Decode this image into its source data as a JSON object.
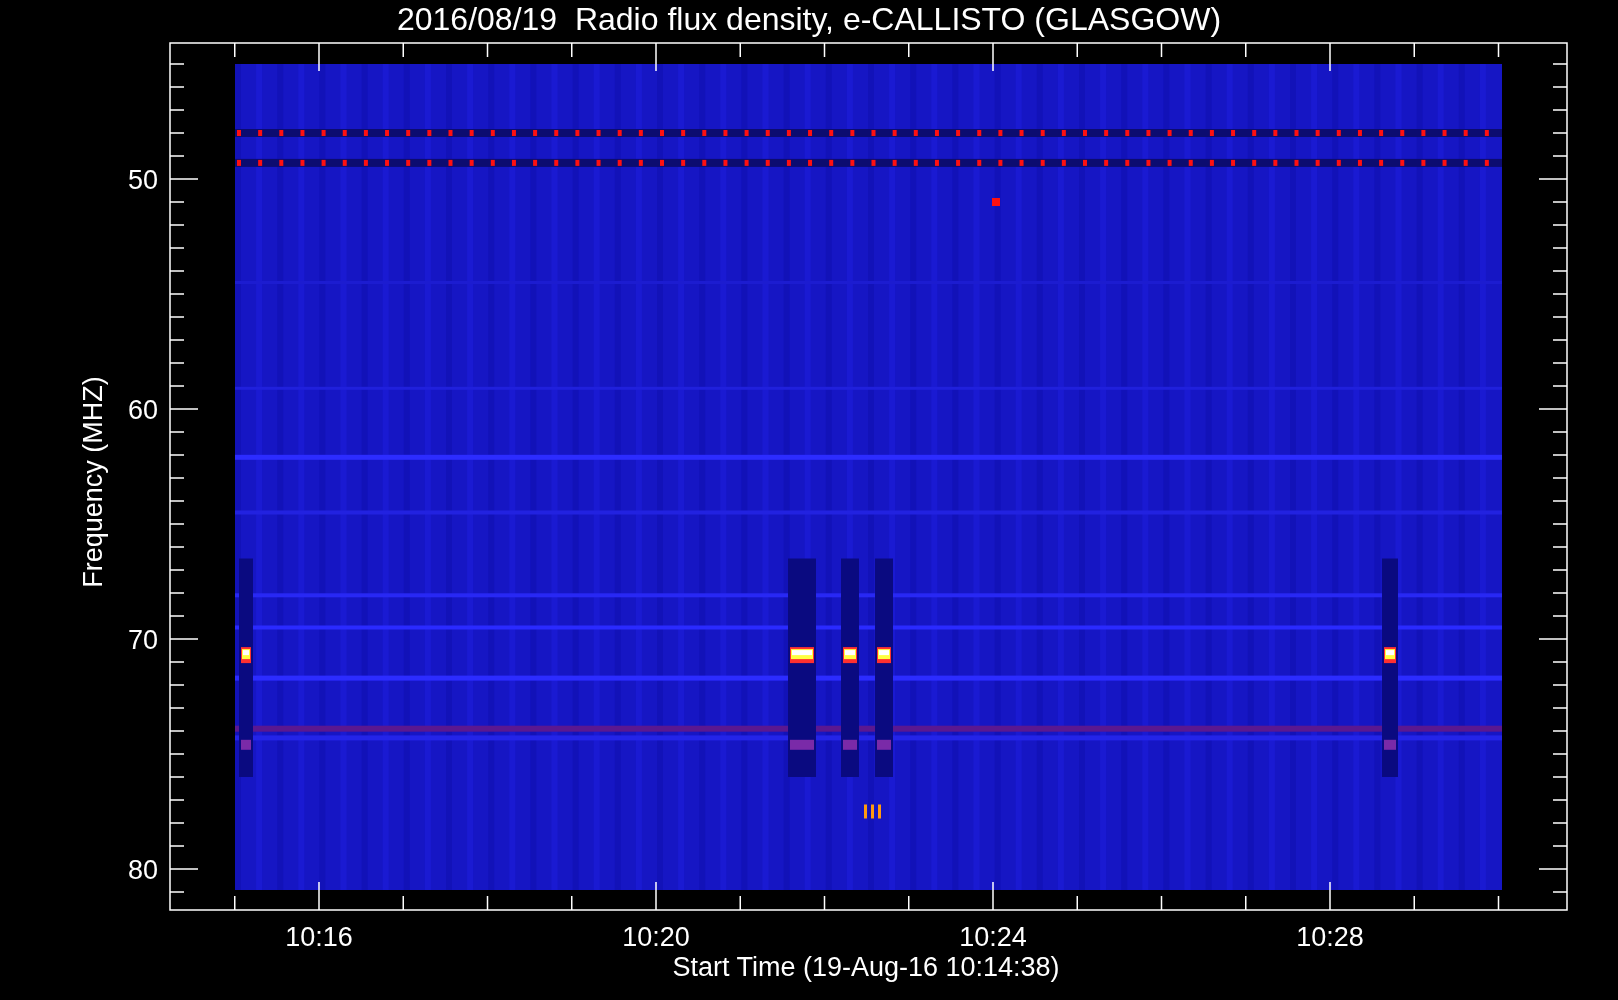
{
  "title": "2016/08/19  Radio flux density, e-CALLISTO (GLASGOW)",
  "plot": {
    "ylabel": "Frequency (MHZ)",
    "xlabel": "Start Time (19-Aug-16 10:14:38)",
    "y_tick_labels": [
      "50",
      "60",
      "70",
      "80"
    ],
    "x_tick_labels": [
      "10:16",
      "10:20",
      "10:24",
      "10:28"
    ]
  }
}
